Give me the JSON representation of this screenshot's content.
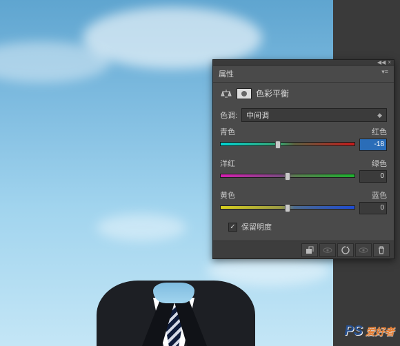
{
  "panel": {
    "title": "属性",
    "adjustment_name": "色彩平衡",
    "tone_label": "色调:",
    "tone_value": "中间调",
    "sliders": [
      {
        "left": "青色",
        "right": "红色",
        "value": "-18",
        "active": true,
        "pos": 43,
        "gradient": "t-cr"
      },
      {
        "left": "洋红",
        "right": "绿色",
        "value": "0",
        "active": false,
        "pos": 50,
        "gradient": "t-mg"
      },
      {
        "left": "黄色",
        "right": "蓝色",
        "value": "0",
        "active": false,
        "pos": 50,
        "gradient": "t-yb"
      }
    ],
    "preserve_label": "保留明度",
    "preserve_checked": true
  },
  "watermark": {
    "ps": "PS",
    "text": "爱好者"
  }
}
